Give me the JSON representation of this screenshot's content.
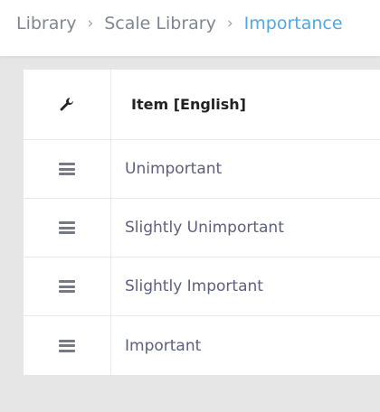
{
  "breadcrumb": {
    "items": [
      "Library",
      "Scale Library"
    ],
    "current": "Importance",
    "separator": "›"
  },
  "table": {
    "header_icon": "wrench-icon",
    "column_header": "Item [English]",
    "rows": [
      {
        "handle_icon": "drag-handle-icon",
        "label": "Unimportant"
      },
      {
        "handle_icon": "drag-handle-icon",
        "label": "Slightly Unimportant"
      },
      {
        "handle_icon": "drag-handle-icon",
        "label": "Slightly Important"
      },
      {
        "handle_icon": "drag-handle-icon",
        "label": "Important"
      }
    ]
  },
  "colors": {
    "breadcrumb_link": "#808690",
    "breadcrumb_active": "#4fa7e6",
    "row_text": "#5d5f7e",
    "background": "#e6e6e6"
  }
}
